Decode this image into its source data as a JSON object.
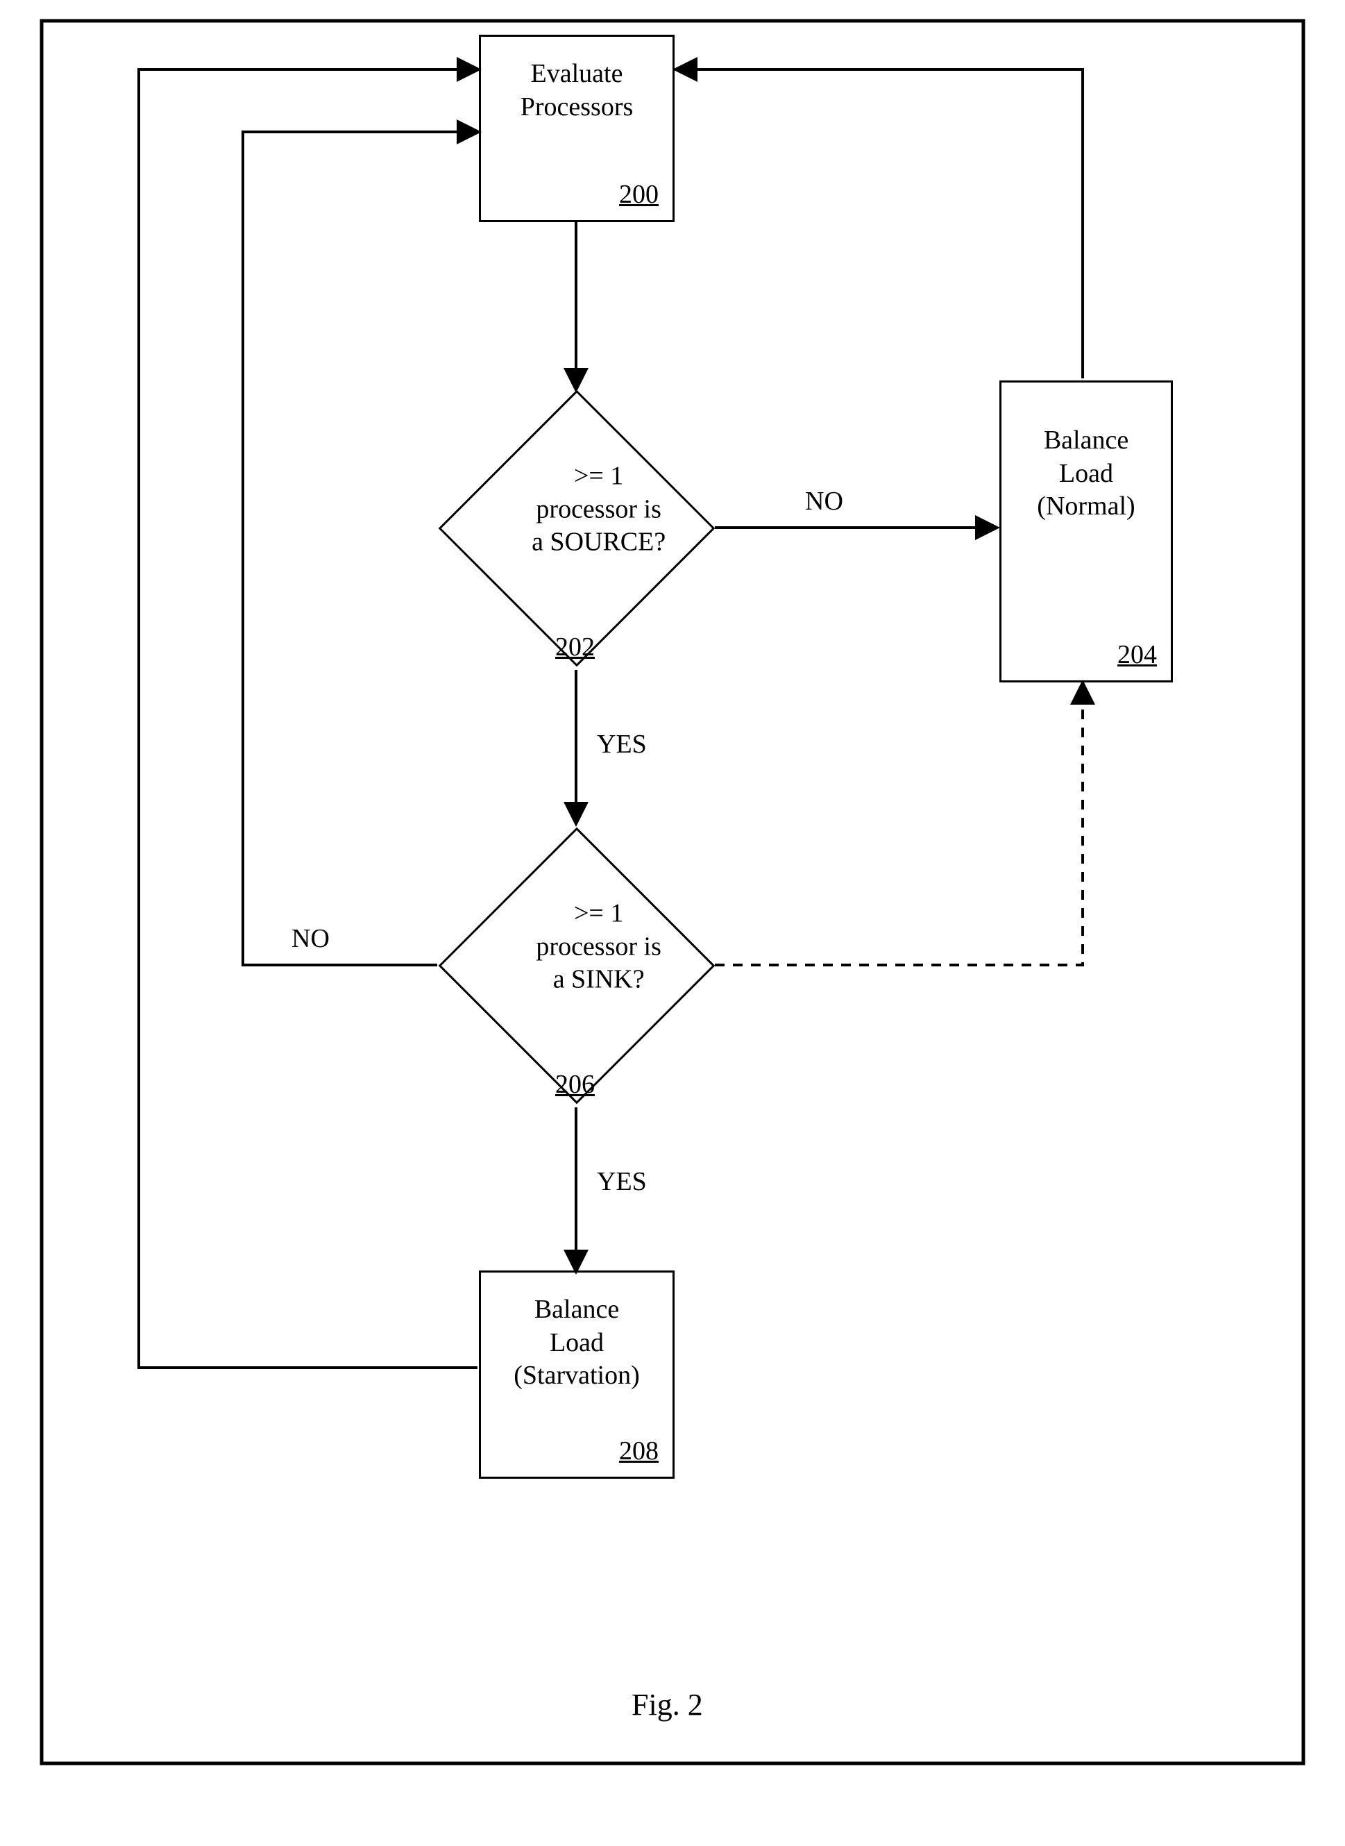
{
  "nodes": {
    "evaluate": {
      "line1": "Evaluate",
      "line2": "Processors",
      "ref": "200"
    },
    "source": {
      "line1": ">= 1",
      "line2": "processor is",
      "line3": "a SOURCE?",
      "ref": "202"
    },
    "normal": {
      "line1": "Balance",
      "line2": "Load",
      "line3": "(Normal)",
      "ref": "204"
    },
    "sink": {
      "line1": ">= 1",
      "line2": "processor is",
      "line3": "a SINK?",
      "ref": "206"
    },
    "starvation": {
      "line1": "Balance",
      "line2": "Load",
      "line3": "(Starvation)",
      "ref": "208"
    }
  },
  "labels": {
    "no": "NO",
    "yes": "YES"
  },
  "caption": "Fig. 2"
}
